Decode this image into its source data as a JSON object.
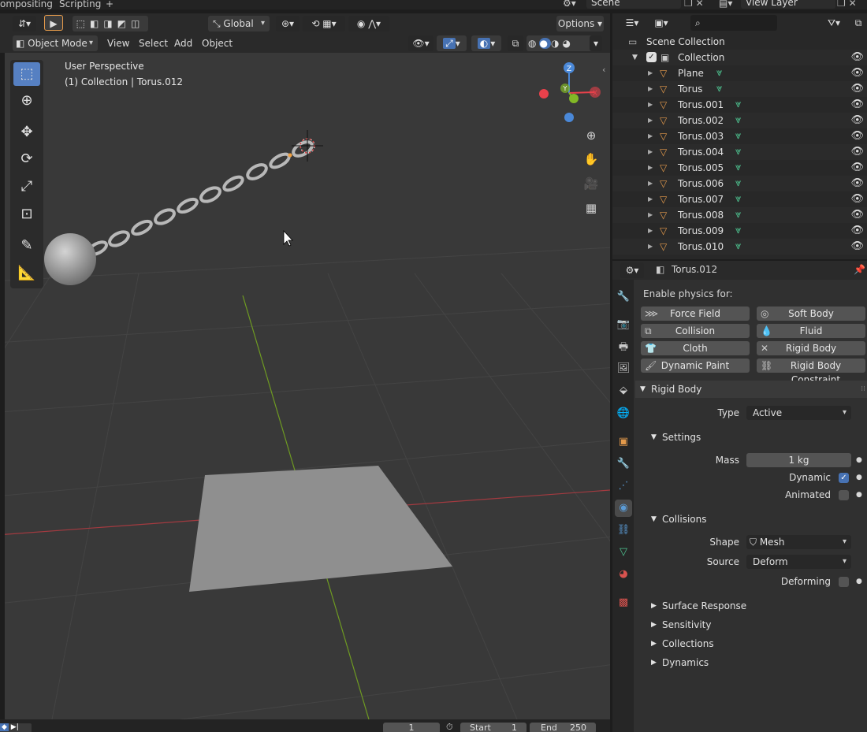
{
  "topbar": {
    "workspace_tabs": [
      "ompositing",
      "Scripting",
      "+"
    ],
    "scene_name": "Scene",
    "view_layer": "View Layer"
  },
  "viewport_header": {
    "transform_orientation": "Global",
    "options_label": "Options",
    "mode": "Object Mode",
    "menus": [
      "View",
      "Select",
      "Add",
      "Object"
    ]
  },
  "viewport": {
    "perspective_label": "User Perspective",
    "collection_label": "(1) Collection | Torus.012"
  },
  "outliner": {
    "search_placeholder": "",
    "scene_collection": "Scene Collection",
    "collection": "Collection",
    "items": [
      "Plane",
      "Torus",
      "Torus.001",
      "Torus.002",
      "Torus.003",
      "Torus.004",
      "Torus.005",
      "Torus.006",
      "Torus.007",
      "Torus.008",
      "Torus.009",
      "Torus.010"
    ]
  },
  "properties": {
    "object_name": "Torus.012",
    "enable_physics_label": "Enable physics for:",
    "physics_buttons": {
      "force_field": "Force Field",
      "soft_body": "Soft Body",
      "collision": "Collision",
      "fluid": "Fluid",
      "cloth": "Cloth",
      "rigid_body": "Rigid Body",
      "dynamic_paint": "Dynamic Paint",
      "rigid_body_constraint": "Rigid Body Constraint"
    },
    "rigid_body_panel": "Rigid Body",
    "type_label": "Type",
    "type_value": "Active",
    "settings_panel": "Settings",
    "mass_label": "Mass",
    "mass_value": "1 kg",
    "dynamic_label": "Dynamic",
    "dynamic_checked": true,
    "animated_label": "Animated",
    "animated_checked": false,
    "collisions_panel": "Collisions",
    "shape_label": "Shape",
    "shape_value": "Mesh",
    "source_label": "Source",
    "source_value": "Deform",
    "deforming_label": "Deforming",
    "deforming_checked": false,
    "subpanels": [
      "Surface Response",
      "Sensitivity",
      "Collections",
      "Dynamics"
    ]
  },
  "timeline": {
    "current_frame": "1",
    "start_label": "Start",
    "start_value": "1",
    "end_label": "End",
    "end_value": "250"
  },
  "colors": {
    "accent": "#4772b3",
    "mesh_icon": "#e49a4b",
    "data_icon": "#4fc793",
    "x_axis": "#e8414b",
    "y_axis": "#82b826",
    "z_axis": "#4a88d8"
  }
}
